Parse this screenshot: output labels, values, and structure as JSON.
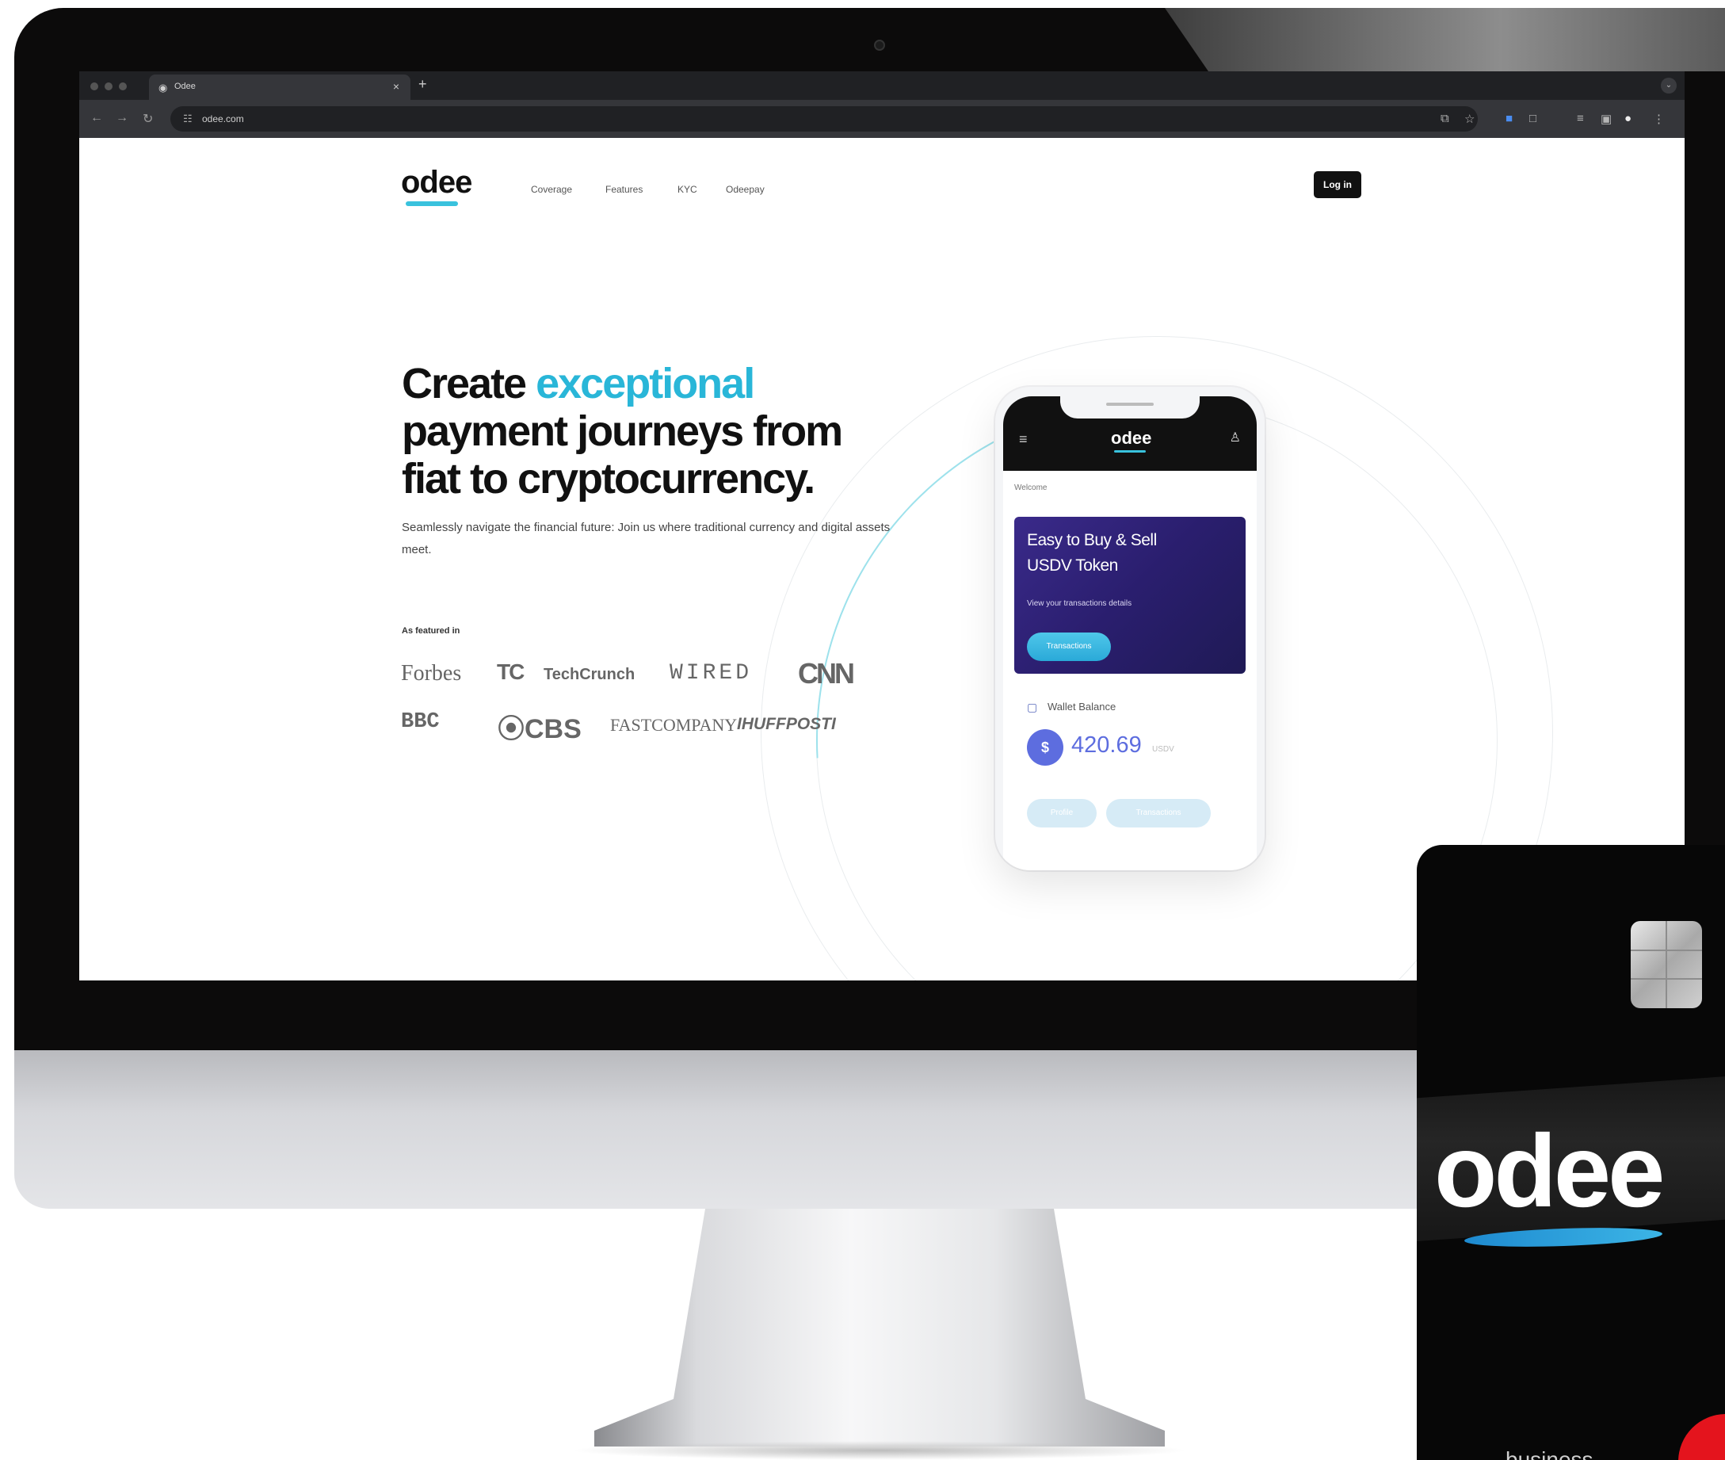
{
  "browser": {
    "tab_title": "Odee",
    "url": "odee.com",
    "new_tab_symbol": "+",
    "close_symbol": "×"
  },
  "site": {
    "logo": "odee",
    "nav": [
      "Coverage",
      "Features",
      "KYC",
      "Odeepay"
    ],
    "login_label": "Log in",
    "hero": {
      "title_part1": "Create ",
      "title_highlight": "exceptional",
      "title_part2": " payment journeys from fiat to cryptocurrency.",
      "subtitle": "Seamlessly navigate the financial future: Join us where traditional currency and digital assets meet."
    },
    "featured_label": "As featured in",
    "press": {
      "forbes": "Forbes",
      "techcrunch_mark": "TC",
      "techcrunch": "TechCrunch",
      "wired": "WIRED",
      "cnn": "CNN",
      "bbc": "BBC",
      "cbs": "⦿CBS",
      "fastcompany": "FASTCOMPANY",
      "huffpost": "IHUFFPOSTI"
    }
  },
  "phone": {
    "logo": "odee",
    "welcome": "Welcome",
    "promo_title": "Easy to Buy & Sell USDV Token",
    "promo_sub": "View your transactions details",
    "promo_button": "Transactions",
    "wallet_label": "Wallet Balance",
    "coin_symbol": "$",
    "balance": "420.69",
    "balance_unit": "USDV",
    "pill_profile": "Profile",
    "pill_transactions": "Transactions"
  },
  "card": {
    "logo": "odee",
    "tier": "business"
  },
  "colors": {
    "accent": "#29b6d8",
    "promo_gradient": "#3a2a8a",
    "balance": "#5d6ddf",
    "card_red": "#e4141d"
  }
}
